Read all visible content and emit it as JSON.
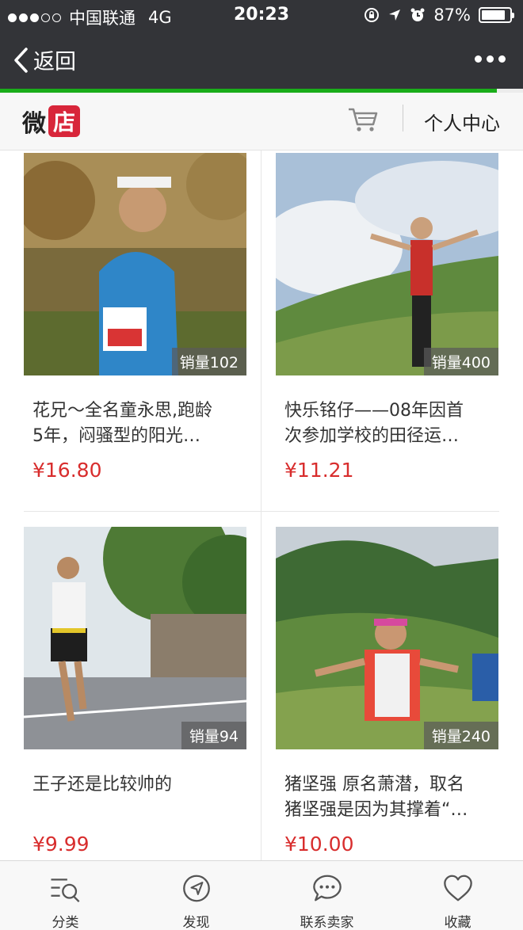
{
  "status": {
    "carrier": "中国联通",
    "network": "4G",
    "time": "20:23",
    "battery": "87%",
    "battery_level": 0.87,
    "signal_bars": 3
  },
  "nav": {
    "back_label": "返回",
    "progress": 0.95
  },
  "shop": {
    "logo_main": "微",
    "logo_badge": "店",
    "user_center": "个人中心"
  },
  "products": [
    {
      "sales": "销量102",
      "title_line1": "花兄～全名童永思,跑龄",
      "title_line2": "5年，闷骚型的阳光…",
      "price": "¥16.80"
    },
    {
      "sales": "销量400",
      "title_line1": "快乐铭仔——08年因首",
      "title_line2": "次参加学校的田径运…",
      "price": "¥11.21"
    },
    {
      "sales": "销量94",
      "title_line1": "王子还是比较帅的",
      "title_line2": "",
      "price": "¥9.99"
    },
    {
      "sales": "销量240",
      "title_line1": "猪坚强 原名萧潜，取名",
      "title_line2": "猪坚强是因为其撑着“…",
      "price": "¥10.00"
    }
  ],
  "tabs": [
    {
      "label": "分类",
      "icon": "category-list-icon"
    },
    {
      "label": "发现",
      "icon": "compass-icon"
    },
    {
      "label": "联系卖家",
      "icon": "chat-bubble-icon"
    },
    {
      "label": "收藏",
      "icon": "heart-icon"
    }
  ],
  "colors": {
    "header_bg": "#333438",
    "progress_green": "#1aad19",
    "price_red": "#d82d2d",
    "logo_red": "#d8263a"
  }
}
